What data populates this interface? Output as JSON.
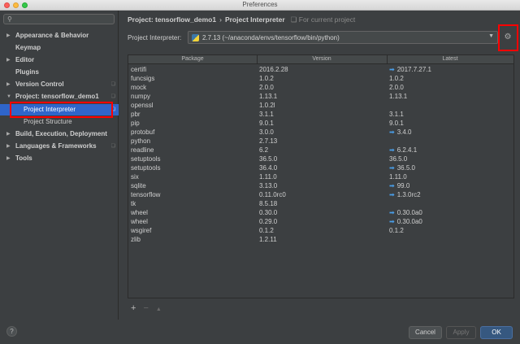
{
  "window": {
    "title": "Preferences"
  },
  "sidebar": {
    "search_icon": "search-icon",
    "items": [
      {
        "label": "Appearance & Behavior",
        "expandable": true
      },
      {
        "label": "Keymap",
        "expandable": false
      },
      {
        "label": "Editor",
        "expandable": true
      },
      {
        "label": "Plugins",
        "expandable": false
      },
      {
        "label": "Version Control",
        "expandable": true
      },
      {
        "label": "Project: tensorflow_demo1",
        "expandable": true,
        "expanded": true
      },
      {
        "label": "Project Interpreter",
        "selected": true
      },
      {
        "label": "Project Structure"
      },
      {
        "label": "Build, Execution, Deployment",
        "expandable": true
      },
      {
        "label": "Languages & Frameworks",
        "expandable": true
      },
      {
        "label": "Tools",
        "expandable": true
      }
    ],
    "help": "?"
  },
  "breadcrumb": {
    "project": "Project: tensorflow_demo1",
    "page": "Project Interpreter",
    "note": "For current project"
  },
  "interpreter": {
    "label": "Project Interpreter:",
    "value": "2.7.13 (~/anaconda/envs/tensorflow/bin/python)"
  },
  "table": {
    "headers": [
      "Package",
      "Version",
      "Latest"
    ],
    "rows": [
      {
        "package": "certifi",
        "version": "2016.2.28",
        "latest": "2017.7.27.1",
        "upgrade": true
      },
      {
        "package": "funcsigs",
        "version": "1.0.2",
        "latest": "1.0.2",
        "upgrade": false
      },
      {
        "package": "mock",
        "version": "2.0.0",
        "latest": "2.0.0",
        "upgrade": false
      },
      {
        "package": "numpy",
        "version": "1.13.1",
        "latest": "1.13.1",
        "upgrade": false
      },
      {
        "package": "openssl",
        "version": "1.0.2l",
        "latest": "",
        "upgrade": false
      },
      {
        "package": "pbr",
        "version": "3.1.1",
        "latest": "3.1.1",
        "upgrade": false
      },
      {
        "package": "pip",
        "version": "9.0.1",
        "latest": "9.0.1",
        "upgrade": false
      },
      {
        "package": "protobuf",
        "version": "3.0.0",
        "latest": "3.4.0",
        "upgrade": true
      },
      {
        "package": "python",
        "version": "2.7.13",
        "latest": "",
        "upgrade": false
      },
      {
        "package": "readline",
        "version": "6.2",
        "latest": "6.2.4.1",
        "upgrade": true
      },
      {
        "package": "setuptools",
        "version": "36.5.0",
        "latest": "36.5.0",
        "upgrade": false
      },
      {
        "package": "setuptools",
        "version": "36.4.0",
        "latest": "36.5.0",
        "upgrade": true
      },
      {
        "package": "six",
        "version": "1.11.0",
        "latest": "1.11.0",
        "upgrade": false
      },
      {
        "package": "sqlite",
        "version": "3.13.0",
        "latest": "99.0",
        "upgrade": true
      },
      {
        "package": "tensorflow",
        "version": "0.11.0rc0",
        "latest": "1.3.0rc2",
        "upgrade": true
      },
      {
        "package": "tk",
        "version": "8.5.18",
        "latest": "",
        "upgrade": false
      },
      {
        "package": "wheel",
        "version": "0.30.0",
        "latest": "0.30.0a0",
        "upgrade": true
      },
      {
        "package": "wheel",
        "version": "0.29.0",
        "latest": "0.30.0a0",
        "upgrade": true
      },
      {
        "package": "wsgiref",
        "version": "0.1.2",
        "latest": "0.1.2",
        "upgrade": false
      },
      {
        "package": "zlib",
        "version": "1.2.11",
        "latest": "",
        "upgrade": false
      }
    ],
    "tools": {
      "add": "+",
      "remove": "−",
      "upgrade": "▲"
    }
  },
  "buttons": {
    "cancel": "Cancel",
    "apply": "Apply",
    "ok": "OK"
  },
  "colors": {
    "selected": "#2f65ca",
    "upgrade_arrow": "#4a9ee8",
    "ok": "#365880",
    "highlight": "#ff0000"
  }
}
